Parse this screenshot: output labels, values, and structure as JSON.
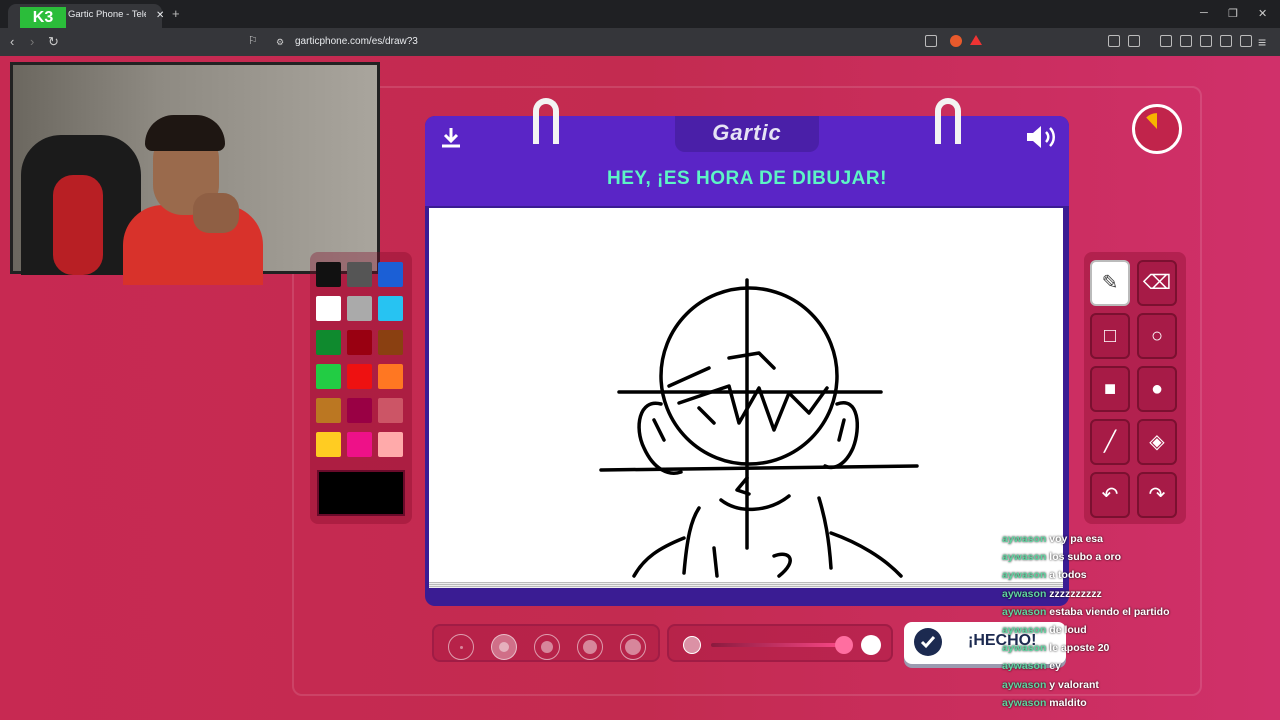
{
  "browser": {
    "tab_logo": "K3",
    "tab_title": "Gartic Phone - Teléfono Desc",
    "tab_close": "✕",
    "new_tab": "+",
    "url": "garticphone.com/es/draw?3",
    "win_min": "─",
    "win_max": "❐",
    "win_close": "✕"
  },
  "game": {
    "logo": "Gartic",
    "headline": "HEY, ¡ES HORA DE DIBUJAR!",
    "done_label": "¡HECHO!"
  },
  "palette": {
    "colors": [
      "#111111",
      "#555555",
      "#1b5fd6",
      "#ffffff",
      "#aaaaaa",
      "#27c3f2",
      "#0f8a2e",
      "#990011",
      "#8a4011",
      "#22cc44",
      "#ee1111",
      "#ff7722",
      "#bb7722",
      "#990044",
      "#cc5566",
      "#ffcc22",
      "#ee1188",
      "#ffaaaa"
    ],
    "current": "#000000"
  },
  "tools": [
    {
      "icon": "pencil-icon",
      "glyph": "✎"
    },
    {
      "icon": "eraser-icon",
      "glyph": "⌫"
    },
    {
      "icon": "rectangle-outline-icon",
      "glyph": "□"
    },
    {
      "icon": "ellipse-outline-icon",
      "glyph": "○"
    },
    {
      "icon": "rectangle-fill-icon",
      "glyph": "■"
    },
    {
      "icon": "ellipse-fill-icon",
      "glyph": "●"
    },
    {
      "icon": "line-icon",
      "glyph": "╱"
    },
    {
      "icon": "bucket-icon",
      "glyph": "◈"
    },
    {
      "icon": "undo-icon",
      "glyph": "↶"
    },
    {
      "icon": "redo-icon",
      "glyph": "↷"
    }
  ],
  "brush_sizes": 5,
  "selected_brush": 2,
  "timer_fraction": 0.12,
  "chat": [
    {
      "user": "aywason",
      "msg": "voy pa esa"
    },
    {
      "user": "aywason",
      "msg": "los subo a oro"
    },
    {
      "user": "aywason",
      "msg": "a todos"
    },
    {
      "user": "aywason",
      "msg": "zzzzzzzzzz"
    },
    {
      "user": "aywason",
      "msg": "estaba viendo el partido"
    },
    {
      "user": "aywason",
      "msg": "de loud"
    },
    {
      "user": "aywason",
      "msg": "le aposte 20"
    },
    {
      "user": "aywason",
      "msg": "ey"
    },
    {
      "user": "aywason",
      "msg": "y valorant"
    },
    {
      "user": "aywason",
      "msg": "maldito"
    }
  ]
}
